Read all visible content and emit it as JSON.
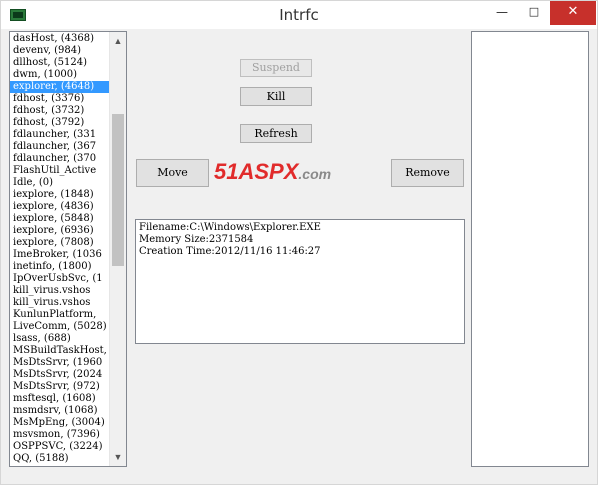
{
  "window": {
    "title": "Intrfc"
  },
  "caption_buttons": {
    "minimize": "—",
    "maximize": "□",
    "close": "✕"
  },
  "process_list": {
    "selected_index": 4,
    "items": [
      "dasHost, (4368)",
      "devenv, (984)",
      "dllhost, (5124)",
      "dwm, (1000)",
      "explorer, (4648)",
      "fdhost, (3376)",
      "fdhost, (3732)",
      "fdhost, (3792)",
      "fdlauncher, (331",
      "fdlauncher, (367",
      "fdlauncher, (370",
      "FlashUtil_Active",
      "Idle, (0)",
      "iexplore, (1848)",
      "iexplore, (4836)",
      "iexplore, (5848)",
      "iexplore, (6936)",
      "iexplore, (7808)",
      "ImeBroker, (1036",
      "inetinfo, (1800)",
      "IpOverUsbSvc, (1",
      "kill_virus.vshos",
      "kill_virus.vshos",
      "KunlunPlatform,",
      "LiveComm, (5028)",
      "lsass, (688)",
      "MSBuildTaskHost,",
      "MsDtsSrvr, (1960",
      "MsDtsSrvr, (2024",
      "MsDtsSrvr, (972)",
      "msftesql, (1608)",
      "msmdsrv, (1068)",
      "MsMpEng, (3004)",
      "msvsmon, (7396)",
      "OSPPSVC, (3224)",
      "QQ, (5188)"
    ]
  },
  "buttons": {
    "suspend": "Suspend",
    "kill": "Kill",
    "refresh": "Refresh",
    "move": "Move",
    "remove": "Remove"
  },
  "info": {
    "filename": "Filename:C:\\Windows\\Explorer.EXE",
    "memory_size": "Memory Size:2371584",
    "creation_time": "Creation Time:2012/11/16 11:46:27"
  },
  "watermark": {
    "number": "51",
    "brand": "ASPX",
    "domain": ".com"
  },
  "scrollbar": {
    "up_arrow": "▲",
    "down_arrow": "▼"
  }
}
